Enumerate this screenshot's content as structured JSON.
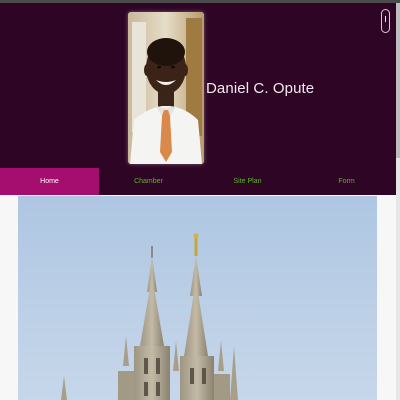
{
  "profile": {
    "name": "Daniel C. Opute"
  },
  "nav": {
    "items": [
      {
        "label": "Home",
        "active": true
      },
      {
        "label": "Chamber",
        "active": false
      },
      {
        "label": "Site Plan",
        "active": false
      },
      {
        "label": "Form",
        "active": false
      }
    ]
  },
  "colors": {
    "header_bg": "#2e0525",
    "nav_active_bg": "#a50e6e",
    "nav_text": "#5ab52b",
    "sky": "#b9cde4"
  },
  "icons": {
    "scroll": "scroll-mouse-icon"
  }
}
